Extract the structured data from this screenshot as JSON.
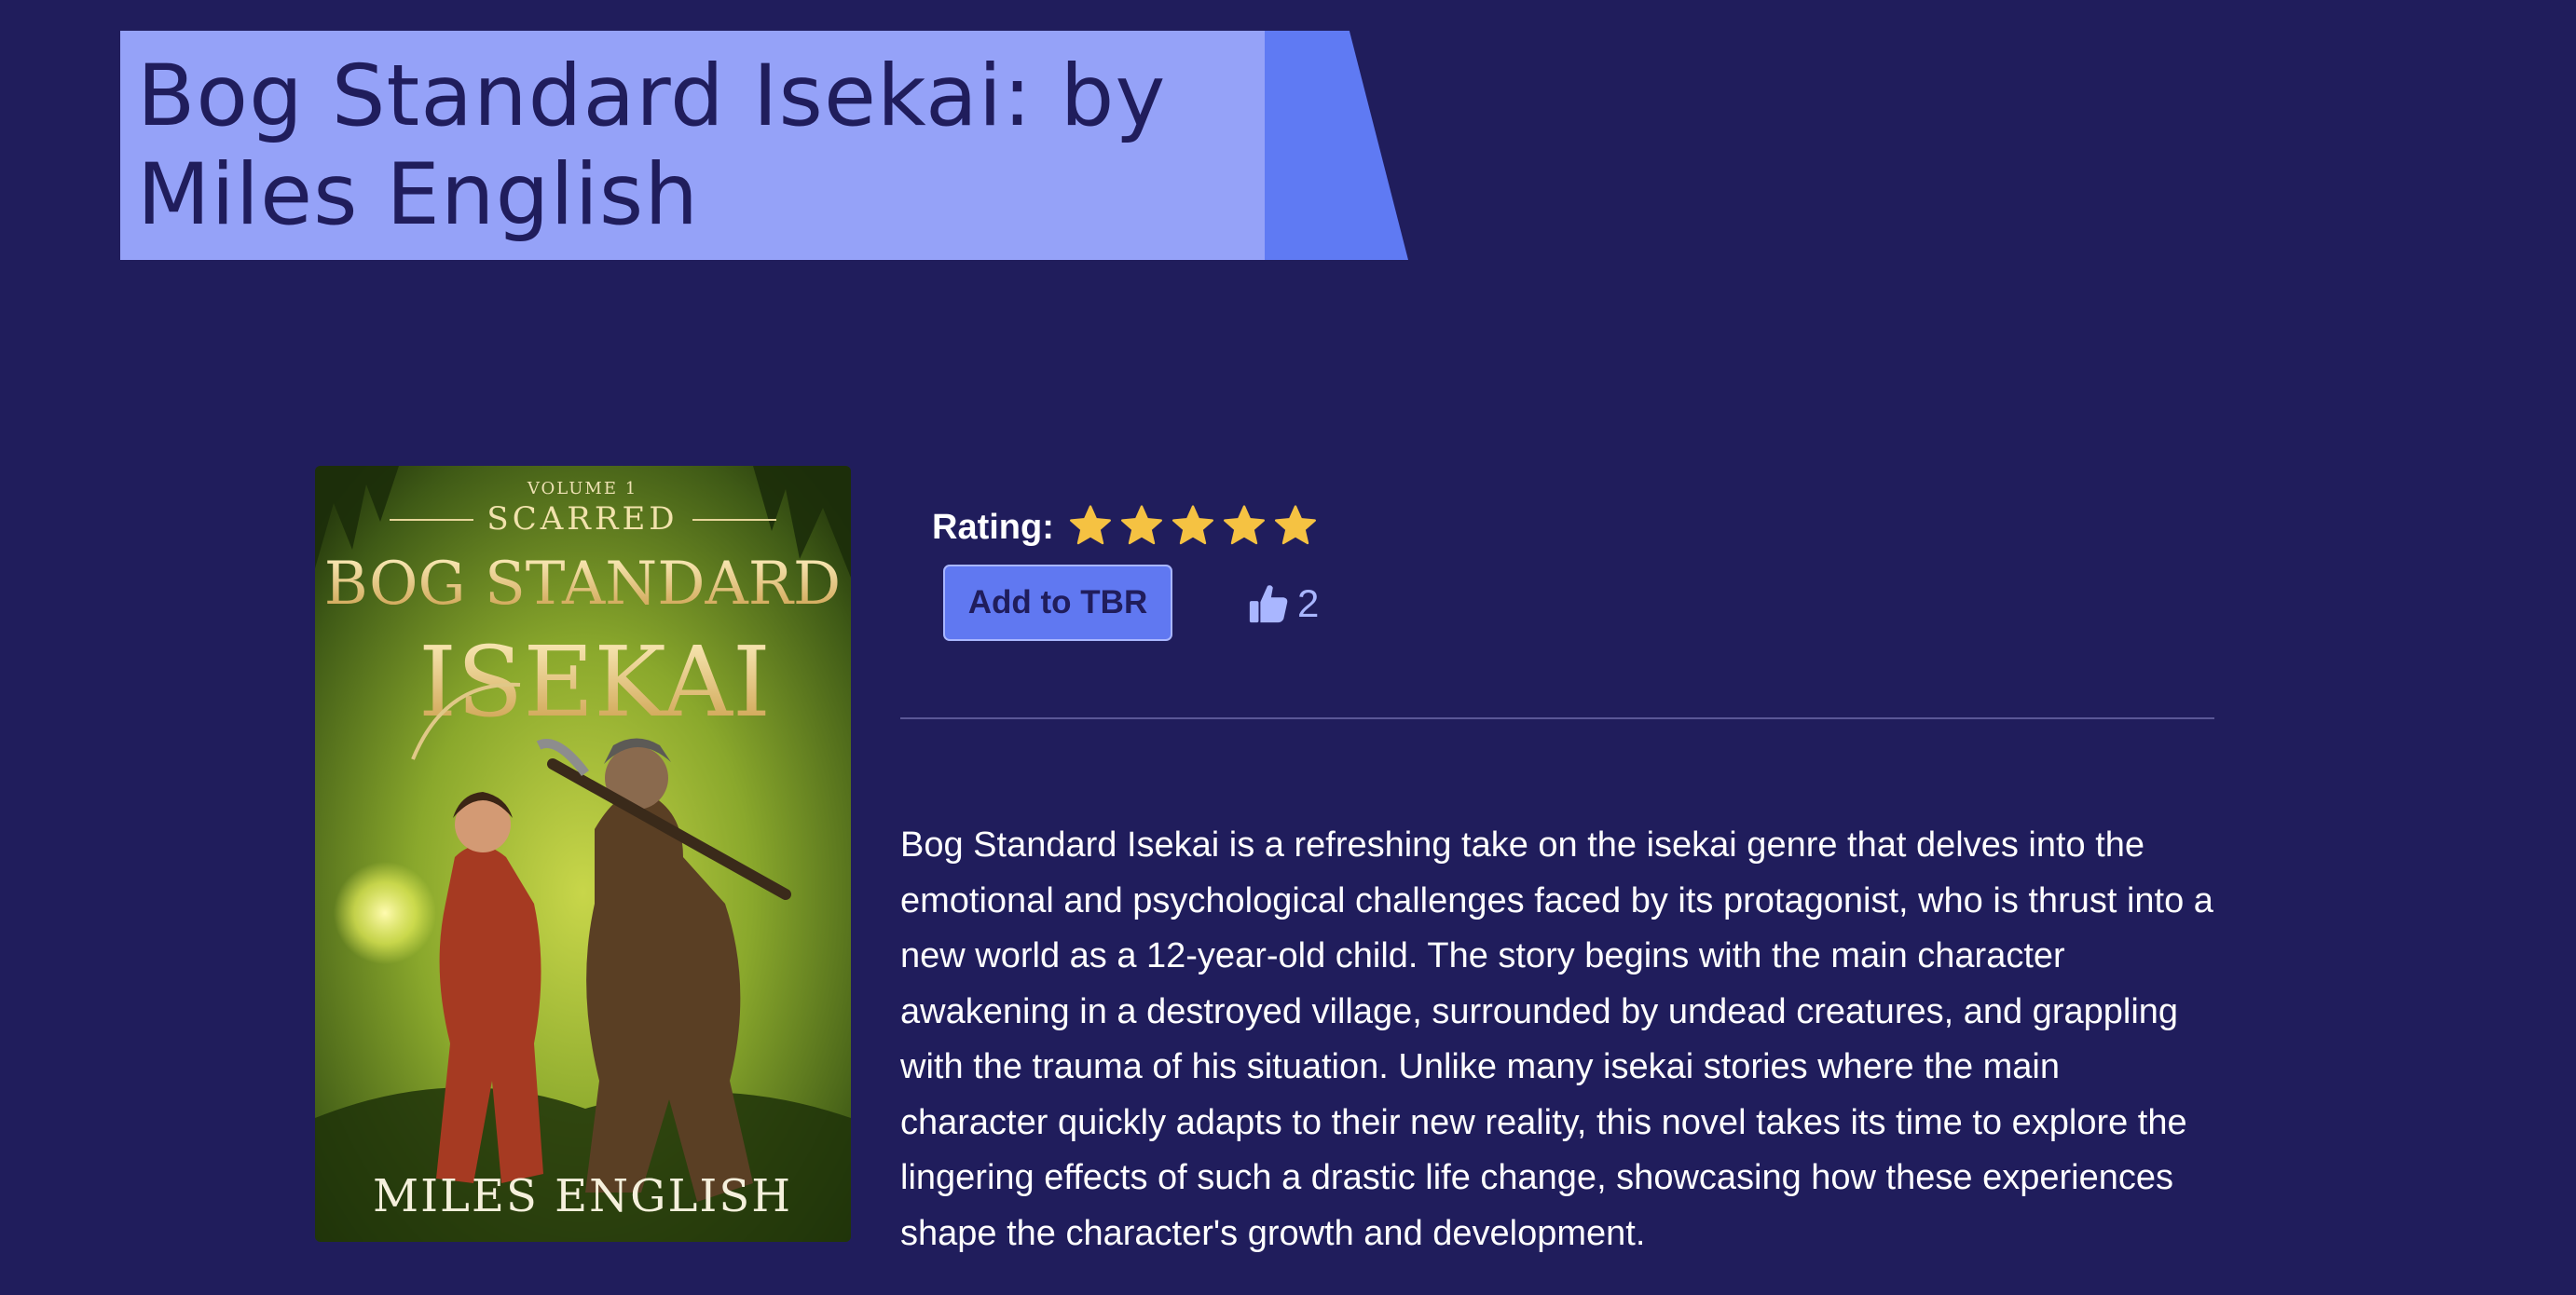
{
  "page": {
    "title": "Bog Standard Isekai: by Miles English"
  },
  "book": {
    "cover": {
      "volume": "VOLUME 1",
      "series": "SCARRED",
      "title_line1": "BOG STANDARD",
      "title_line2": "ISEKAI",
      "author": "MILES ENGLISH"
    },
    "rating_label": "Rating:",
    "rating": 5,
    "rating_max": 5,
    "add_button_label": "Add to TBR",
    "likes": "2",
    "description": "Bog Standard Isekai is a refreshing take on the isekai genre that delves into the emotional and psychological challenges faced by its protagonist, who is thrust into a new world as a 12-year-old child. The story begins with the main character awakening in a destroyed village, surrounded by undead creatures, and grappling with the trauma of his situation. Unlike many isekai stories where the main character quickly adapts to their new reality, this novel takes its time to explore the lingering effects of such a drastic life change, showcasing how these experiences shape the character's growth and development."
  },
  "icons": {
    "star": "star-icon",
    "like": "thumbs-up-icon"
  },
  "colors": {
    "background": "#201d5c",
    "banner": "#95a2f8",
    "banner_accent": "#5f7af3",
    "button": "#6078f1",
    "star": "#f5c242",
    "like": "#a9b6ff"
  }
}
